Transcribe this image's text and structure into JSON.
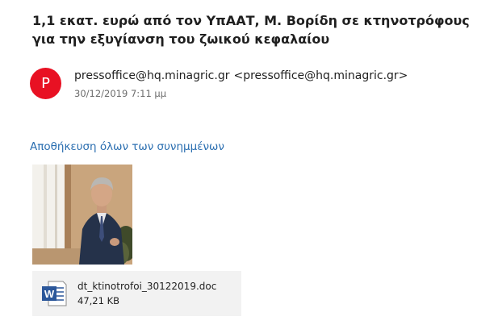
{
  "email": {
    "subject": "1,1 εκατ. ευρώ από τον ΥπΑΑΤ, Μ. Βορίδη σε κτηνοτρόφους για την εξυγίανση του ζωικού κεφαλαίου",
    "sender": {
      "avatar_letter": "P",
      "avatar_color": "#e81123",
      "name": "pressoffice@hq.minagric.gr",
      "email": "<pressoffice@hq.minagric.gr>"
    },
    "date": "30/12/2019 7:11 μμ"
  },
  "attachments": {
    "save_all_label": "Αποθήκευση όλων των συνημμένων",
    "link_color": "#2a6eb0",
    "items": [
      {
        "type": "image",
        "icon": "photo-thumbnail"
      },
      {
        "type": "word-document",
        "icon": "word-doc-icon",
        "filename": "dt_ktinotrofoi_30122019.doc",
        "size": "47,21 KB"
      }
    ]
  }
}
